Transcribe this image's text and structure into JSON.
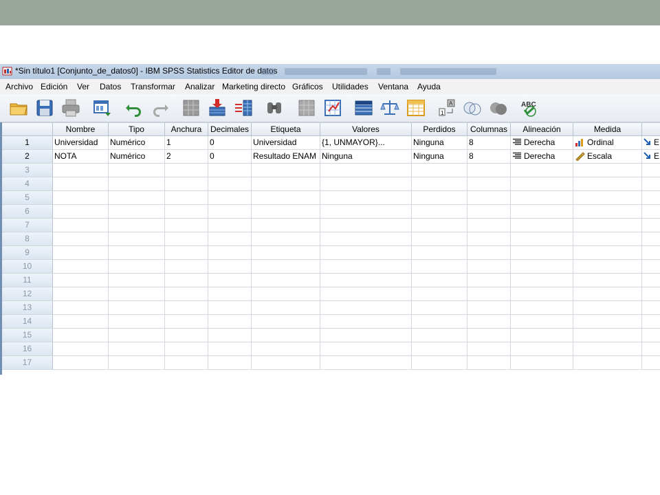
{
  "window": {
    "title": "*Sin título1 [Conjunto_de_datos0] - IBM SPSS Statistics Editor de datos"
  },
  "menu": [
    "Archivo",
    "Edición",
    "Ver",
    "Datos",
    "Transformar",
    "Analizar",
    "Marketing directo",
    "Gráficos",
    "Utilidades",
    "Ventana",
    "Ayuda"
  ],
  "toolbar": [
    {
      "name": "open-icon"
    },
    {
      "name": "save-icon"
    },
    {
      "name": "print-icon"
    },
    {
      "name": "dialog-recall-icon"
    },
    {
      "name": "undo-icon"
    },
    {
      "name": "redo-icon"
    },
    {
      "name": "goto-case-icon"
    },
    {
      "name": "goto-variable-icon"
    },
    {
      "name": "variables-icon"
    },
    {
      "name": "find-icon"
    },
    {
      "name": "insert-cases-icon"
    },
    {
      "name": "insert-variable-icon"
    },
    {
      "name": "split-file-icon"
    },
    {
      "name": "weight-cases-icon"
    },
    {
      "name": "select-cases-icon"
    },
    {
      "name": "value-labels-icon"
    },
    {
      "name": "use-sets-icon"
    },
    {
      "name": "show-all-variables-icon"
    },
    {
      "name": "spell-check-icon"
    }
  ],
  "columns": [
    "Nombre",
    "Tipo",
    "Anchura",
    "Decimales",
    "Etiqueta",
    "Valores",
    "Perdidos",
    "Columnas",
    "Alineación",
    "Medida",
    ""
  ],
  "rows": [
    {
      "num": "1",
      "cells": [
        "Universidad",
        "Numérico",
        "1",
        "0",
        "Universidad",
        "{1, UNMAYOR}...",
        "Ninguna",
        "8",
        "Derecha",
        "Ordinal",
        "E"
      ]
    },
    {
      "num": "2",
      "cells": [
        "NOTA",
        "Numérico",
        "2",
        "0",
        "Resultado ENAM",
        "Ninguna",
        "Ninguna",
        "8",
        "Derecha",
        "Escala",
        "E"
      ]
    }
  ],
  "empty_rows": [
    "3",
    "4",
    "5",
    "6",
    "7",
    "8",
    "9",
    "10",
    "11",
    "12",
    "13",
    "14",
    "15",
    "16",
    "17"
  ]
}
